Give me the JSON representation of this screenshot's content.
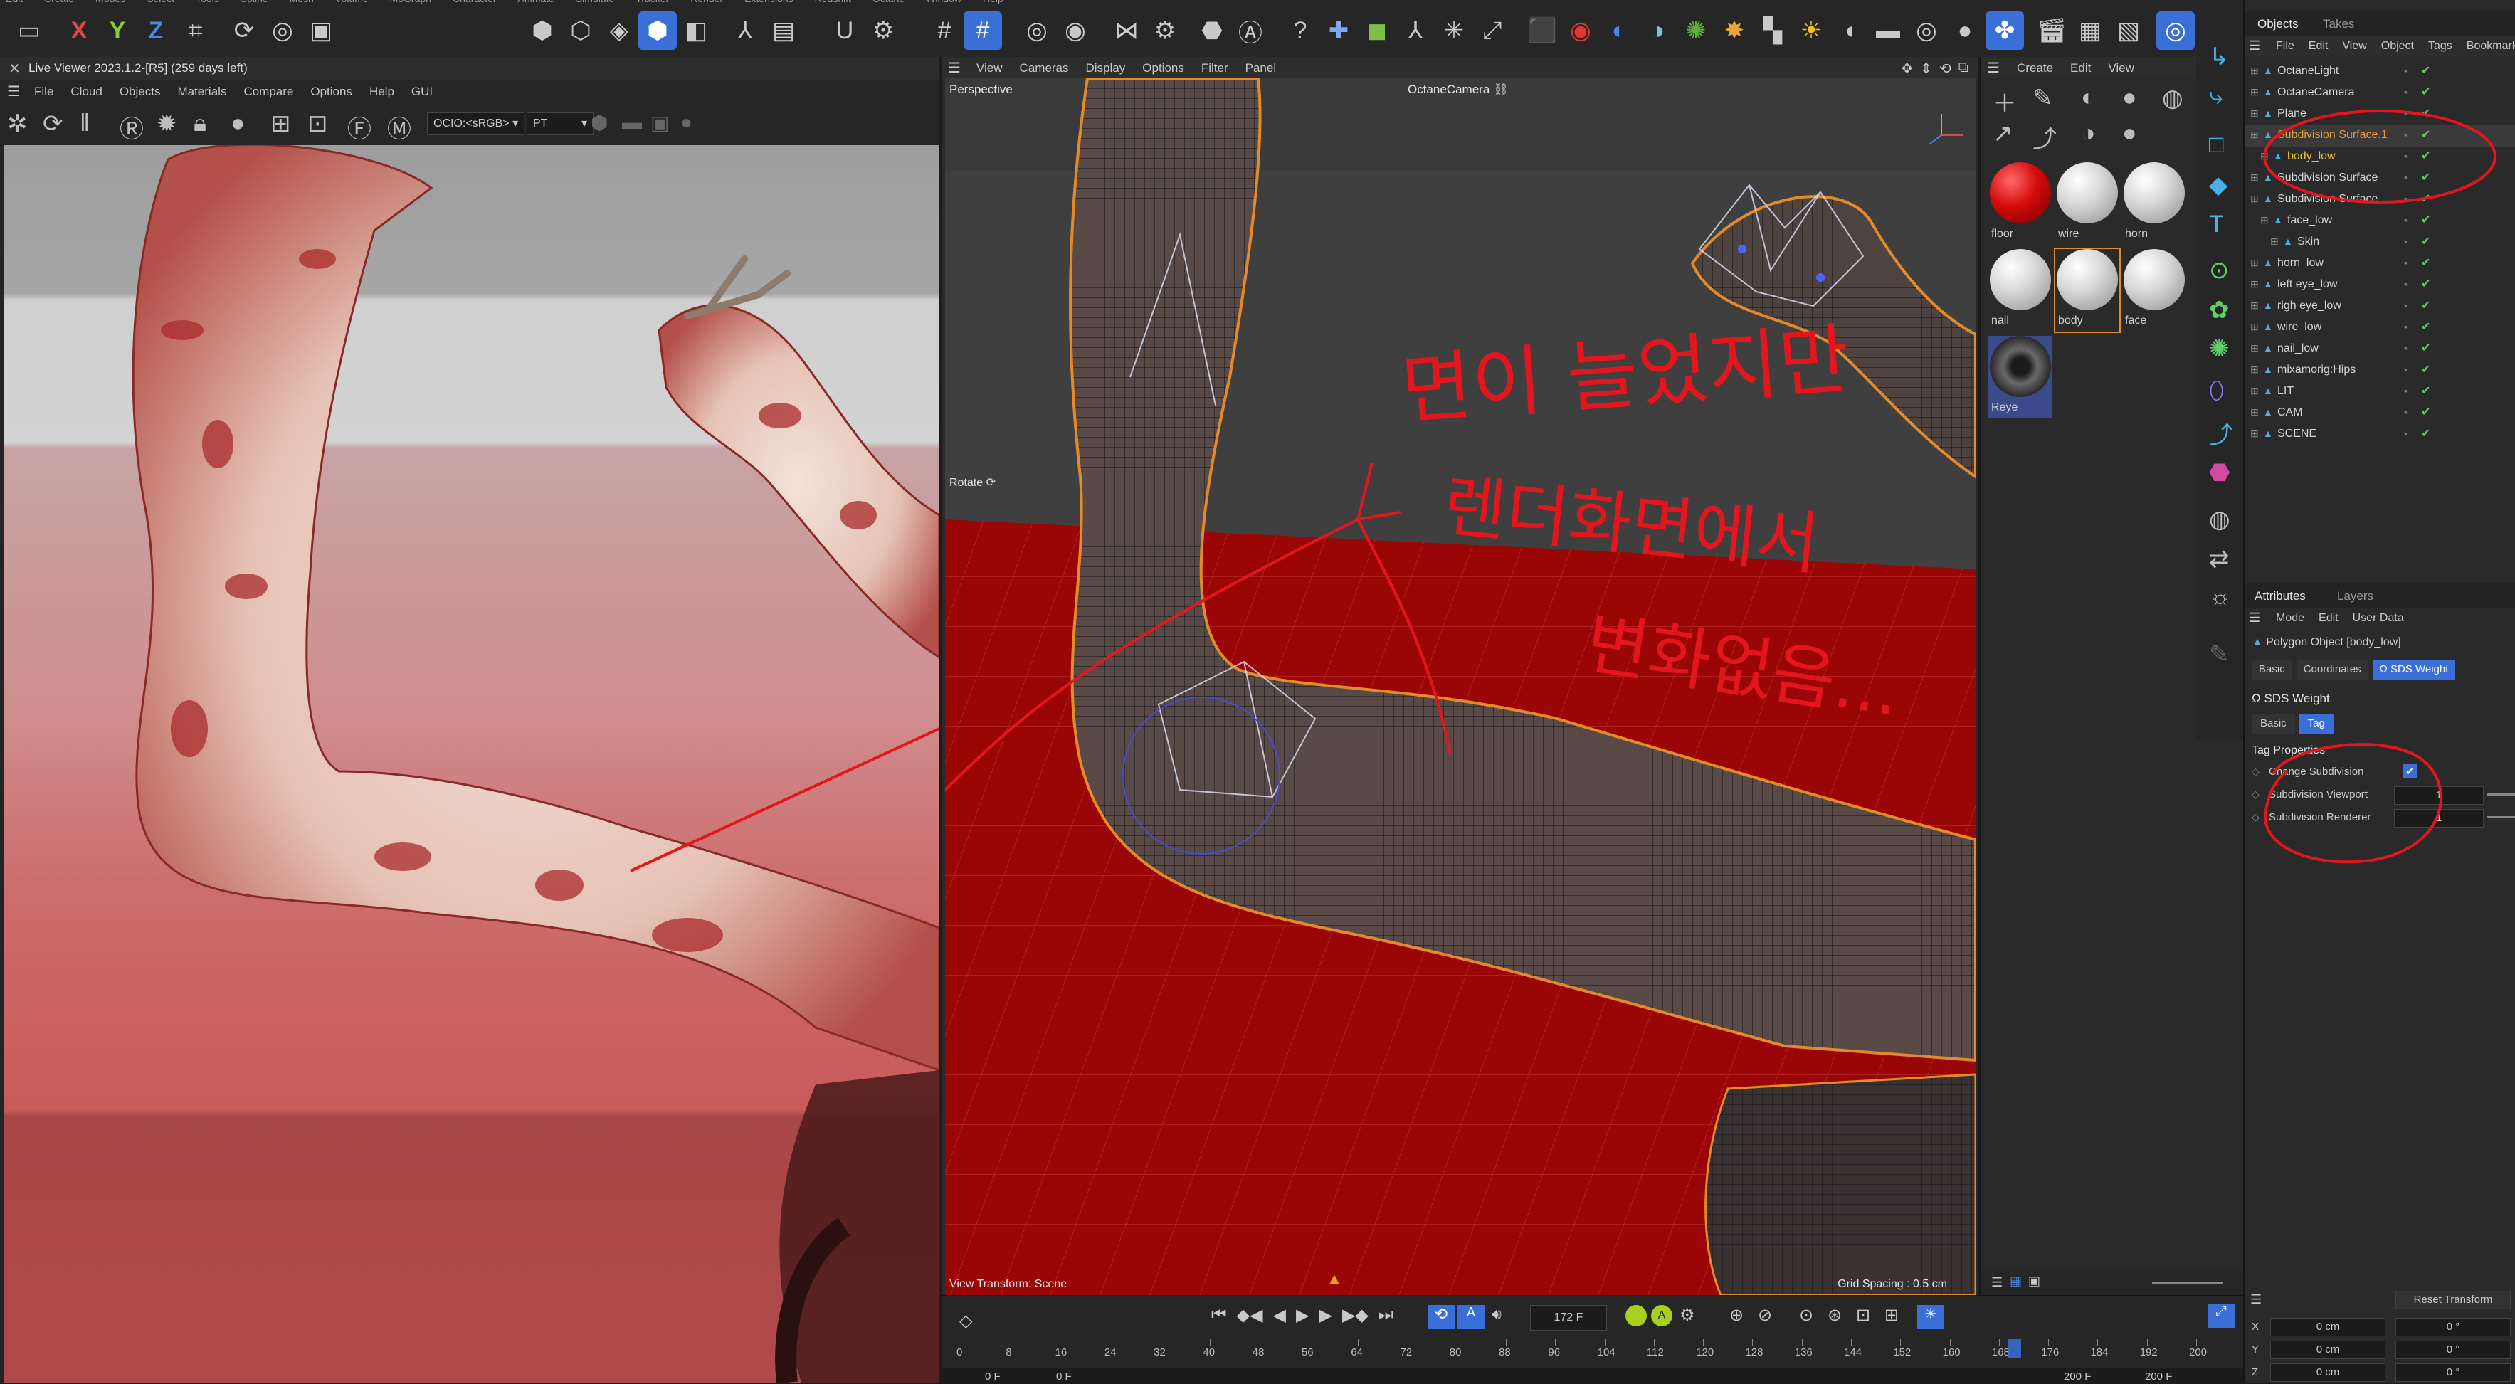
{
  "app": {
    "top_menu": [
      "Edit",
      "Create",
      "Modes",
      "Select",
      "Tools",
      "Spline",
      "Mesh",
      "Volume",
      "MoGraph",
      "Character",
      "Animate",
      "Simulate",
      "Tracker",
      "Render",
      "Extensions",
      "Redshift",
      "Octane",
      "Window",
      "Help"
    ],
    "axis_labels": [
      "X",
      "Y",
      "Z"
    ]
  },
  "live_viewer": {
    "title": "Live Viewer 2023.1.2-[R5] (259 days left)",
    "menu": [
      "File",
      "Cloud",
      "Objects",
      "Materials",
      "Compare",
      "Options",
      "Help",
      "GUI"
    ],
    "ocio": "OCIO:<sRGB>",
    "mode": "PT"
  },
  "viewport": {
    "menu": [
      "View",
      "Cameras",
      "Display",
      "Options",
      "Filter",
      "Panel"
    ],
    "label": "Perspective",
    "camera": "OctaneCamera",
    "rotate_label": "Rotate",
    "view_transform": "View Transform: Scene",
    "grid_spacing": "Grid Spacing : 0.5 cm",
    "annotation_lines": [
      "면이 늘었지만",
      "렌더화면에서",
      "변화없음..."
    ]
  },
  "materials": {
    "menu": [
      "Create",
      "Edit",
      "View"
    ],
    "items": [
      {
        "label": "floor",
        "kind": "red"
      },
      {
        "label": "wire",
        "kind": "white"
      },
      {
        "label": "horn",
        "kind": "white"
      },
      {
        "label": "nail",
        "kind": "white"
      },
      {
        "label": "body",
        "kind": "white"
      },
      {
        "label": "face",
        "kind": "white"
      },
      {
        "label": "Reye",
        "kind": "eye"
      }
    ]
  },
  "objects": {
    "tabs": [
      "Objects",
      "Takes"
    ],
    "menu": [
      "File",
      "Edit",
      "View",
      "Object",
      "Tags",
      "Bookmarks"
    ],
    "rows": [
      {
        "label": "OctaneLight",
        "indent": 0,
        "color": "#d4d4d4"
      },
      {
        "label": "OctaneCamera",
        "indent": 0,
        "color": "#d4d4d4"
      },
      {
        "label": "Plane",
        "indent": 0,
        "color": "#d4d4d4"
      },
      {
        "label": "Subdivision Surface.1",
        "indent": 0,
        "color": "#e89a3c"
      },
      {
        "label": "body_low",
        "indent": 1,
        "color": "#e8c23c"
      },
      {
        "label": "Subdivision Surface",
        "indent": 0,
        "color": "#d4d4d4"
      },
      {
        "label": "Subdivision Surface",
        "indent": 0,
        "color": "#d4d4d4"
      },
      {
        "label": "face_low",
        "indent": 1,
        "color": "#d4d4d4"
      },
      {
        "label": "Skin",
        "indent": 2,
        "color": "#d4d4d4"
      },
      {
        "label": "horn_low",
        "indent": 0,
        "color": "#d4d4d4"
      },
      {
        "label": "left eye_low",
        "indent": 0,
        "color": "#d4d4d4"
      },
      {
        "label": "righ eye_low",
        "indent": 0,
        "color": "#d4d4d4"
      },
      {
        "label": "wire_low",
        "indent": 0,
        "color": "#d4d4d4"
      },
      {
        "label": "nail_low",
        "indent": 0,
        "color": "#d4d4d4"
      },
      {
        "label": "mixamorig:Hips",
        "indent": 0,
        "color": "#d4d4d4"
      },
      {
        "label": "LIT",
        "indent": 0,
        "color": "#d4d4d4"
      },
      {
        "label": "CAM",
        "indent": 0,
        "color": "#d4d4d4"
      },
      {
        "label": "SCENE",
        "indent": 0,
        "color": "#d4d4d4"
      }
    ]
  },
  "attributes": {
    "tabs": [
      "Attributes",
      "Layers"
    ],
    "menu": [
      "Mode",
      "Edit",
      "User Data"
    ],
    "object_title": "Polygon Object [body_low]",
    "sub_tabs": [
      "Basic",
      "Coordinates",
      "SDS Weight"
    ],
    "section": "SDS Weight",
    "tag_tabs": [
      "Basic",
      "Tag"
    ],
    "group": "Tag Properties",
    "props": [
      {
        "label": "Change Subdivision",
        "value": "✔"
      },
      {
        "label": "Subdivision Viewport",
        "value": "1"
      },
      {
        "label": "Subdivision Renderer",
        "value": "1"
      }
    ],
    "reset_label": "Reset Transform",
    "coords": [
      {
        "axis": "X",
        "pos": "0 cm",
        "rot": "0 °"
      },
      {
        "axis": "Y",
        "pos": "0 cm",
        "rot": "0 °"
      },
      {
        "axis": "Z",
        "pos": "0 cm",
        "rot": "0 °"
      }
    ]
  },
  "timeline": {
    "current_frame": "172 F",
    "ticks": [
      "0",
      "8",
      "16",
      "24",
      "32",
      "40",
      "48",
      "56",
      "64",
      "72",
      "80",
      "88",
      "96",
      "104",
      "112",
      "120",
      "128",
      "136",
      "144",
      "152",
      "160",
      "168",
      "176",
      "184",
      "192",
      "200"
    ],
    "playhead_label": "172",
    "start": "0 F",
    "start2": "0 F",
    "end": "200 F",
    "end2": "200 F"
  },
  "colors": {
    "accent_blue": "#3a6fd8",
    "annotation_red": "#e3161e",
    "floor_red": "#9a0606"
  }
}
